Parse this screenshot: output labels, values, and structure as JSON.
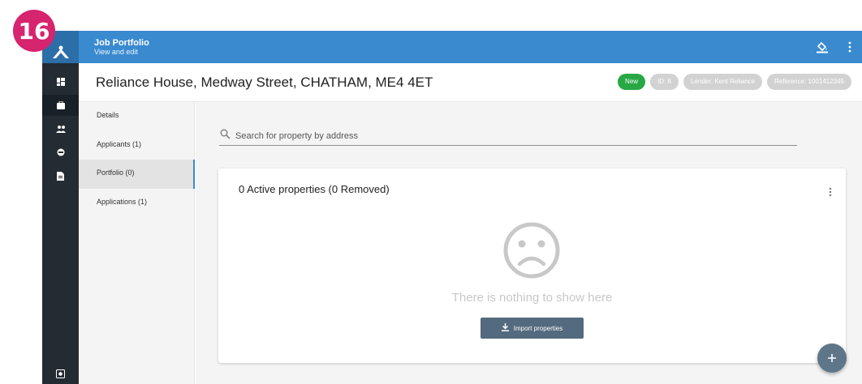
{
  "step_badge": "16",
  "header": {
    "title": "Job Portfolio",
    "subtitle": "View and edit",
    "bg_color": "#3a8ad0",
    "icons": [
      "logo-icon",
      "paint-bucket-icon",
      "more-vertical-icon"
    ]
  },
  "rail": {
    "items": [
      "dashboard-icon",
      "job-icon",
      "people-icon",
      "landlord-icon",
      "document-icon"
    ],
    "active_index": 1,
    "footer_icon": "settings-icon"
  },
  "page": {
    "title": "Reliance House, Medway Street, CHATHAM, ME4 4ET",
    "chips": [
      "New",
      "ID: 8",
      "Lender: Kent Reliance",
      "Reference: 1001412345"
    ],
    "status_color": "#27a845"
  },
  "subnav": {
    "items": [
      {
        "label": "Details"
      },
      {
        "label": "Applicants (1)"
      },
      {
        "label": "Portfolio (0)"
      },
      {
        "label": "Applications (1)"
      }
    ],
    "active_index": 2
  },
  "search": {
    "placeholder": "Search for property by address",
    "value": ""
  },
  "card": {
    "title": "0 Active properties (0 Removed)",
    "empty_text": "There is nothing to show here",
    "import_label": "Import properties"
  },
  "fab_icon": "plus-icon"
}
